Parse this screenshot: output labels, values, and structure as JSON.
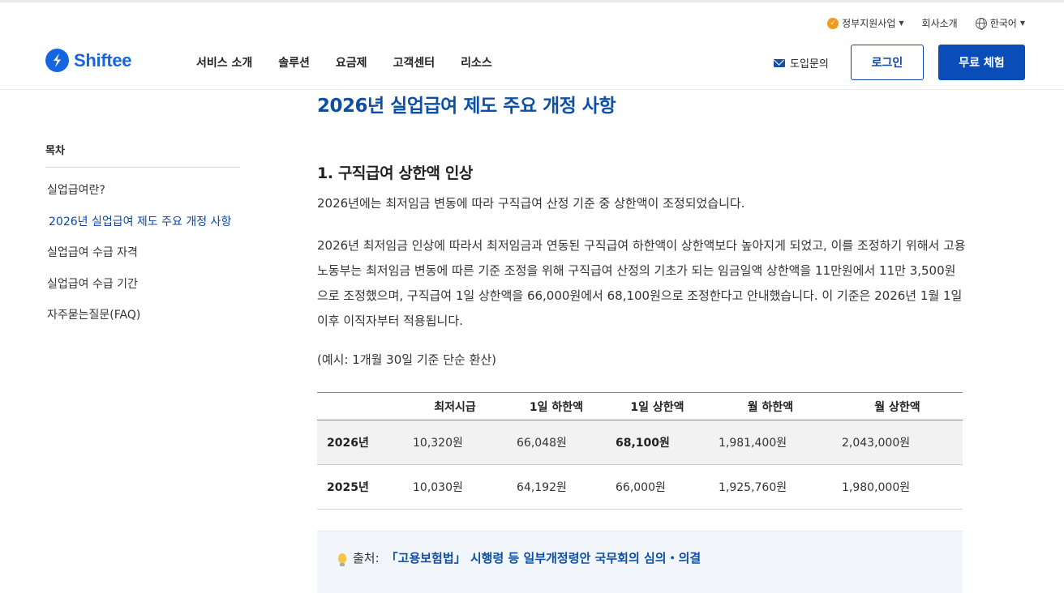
{
  "header": {
    "utility": {
      "gov_label": "정부지원사업",
      "company_label": "회사소개",
      "language_label": "한국어"
    },
    "logo_text": "Shiftee",
    "nav": [
      "서비스 소개",
      "솔루션",
      "요금제",
      "고객센터",
      "리소스"
    ],
    "inquiry_label": "도입문의",
    "login_label": "로그인",
    "trial_label": "무료 체험"
  },
  "sidebar": {
    "title": "목차",
    "items": [
      {
        "label": "실업급여란?",
        "active": false
      },
      {
        "label": "2026년 실업급여 제도 주요 개정 사항",
        "active": true
      },
      {
        "label": "실업급여 수급 자격",
        "active": false
      },
      {
        "label": "실업급여 수급 기간",
        "active": false
      },
      {
        "label": "자주묻는질문(FAQ)",
        "active": false
      }
    ]
  },
  "article": {
    "heading": "2026년 실업급여 제도 주요 개정 사항",
    "subheading": "1. 구직급여 상한액 인상",
    "para1": "2026년에는 최저임금 변동에 따라 구직급여 산정 기준 중 상한액이 조정되었습니다.",
    "para2": "2026년 최저임금 인상에 따라서 최저임금과 연동된 구직급여 하한액이 상한액보다 높아지게 되었고, 이를 조정하기 위해서 고용노동부는 최저임금 변동에 따른 기준 조정을 위해 구직급여 산정의 기초가 되는 임금일액 상한액을 11만원에서 11만 3,500원으로 조정했으며, 구직급여 1일 상한액을 66,000원에서 68,100원으로 조정한다고 안내했습니다. 이 기준은 2026년 1월 1일 이후 이직자부터 적용됩니다.",
    "para3": "(예시: 1개월 30일 기준 단순 환산)",
    "table": {
      "headers": [
        "",
        "최저시급",
        "1일 하한액",
        "1일 상한액",
        "월 하한액",
        "월 상한액"
      ],
      "rows": [
        [
          "2026년",
          "10,320원",
          "66,048원",
          "68,100원",
          "1,981,400원",
          "2,043,000원"
        ],
        [
          "2025년",
          "10,030원",
          "64,192원",
          "66,000원",
          "1,925,760원",
          "1,980,000원"
        ]
      ]
    },
    "source": {
      "prefix": "출처:",
      "link_text": "「고용보험법」 시행령 등 일부개정령안 국무회의 심의・의결"
    }
  },
  "colors": {
    "brand": "#1565e0",
    "heading": "#0c4fa6",
    "primary_button": "#0b4db8",
    "table_highlight": "#f2f2f2",
    "source_bg": "#f2f6fa"
  }
}
